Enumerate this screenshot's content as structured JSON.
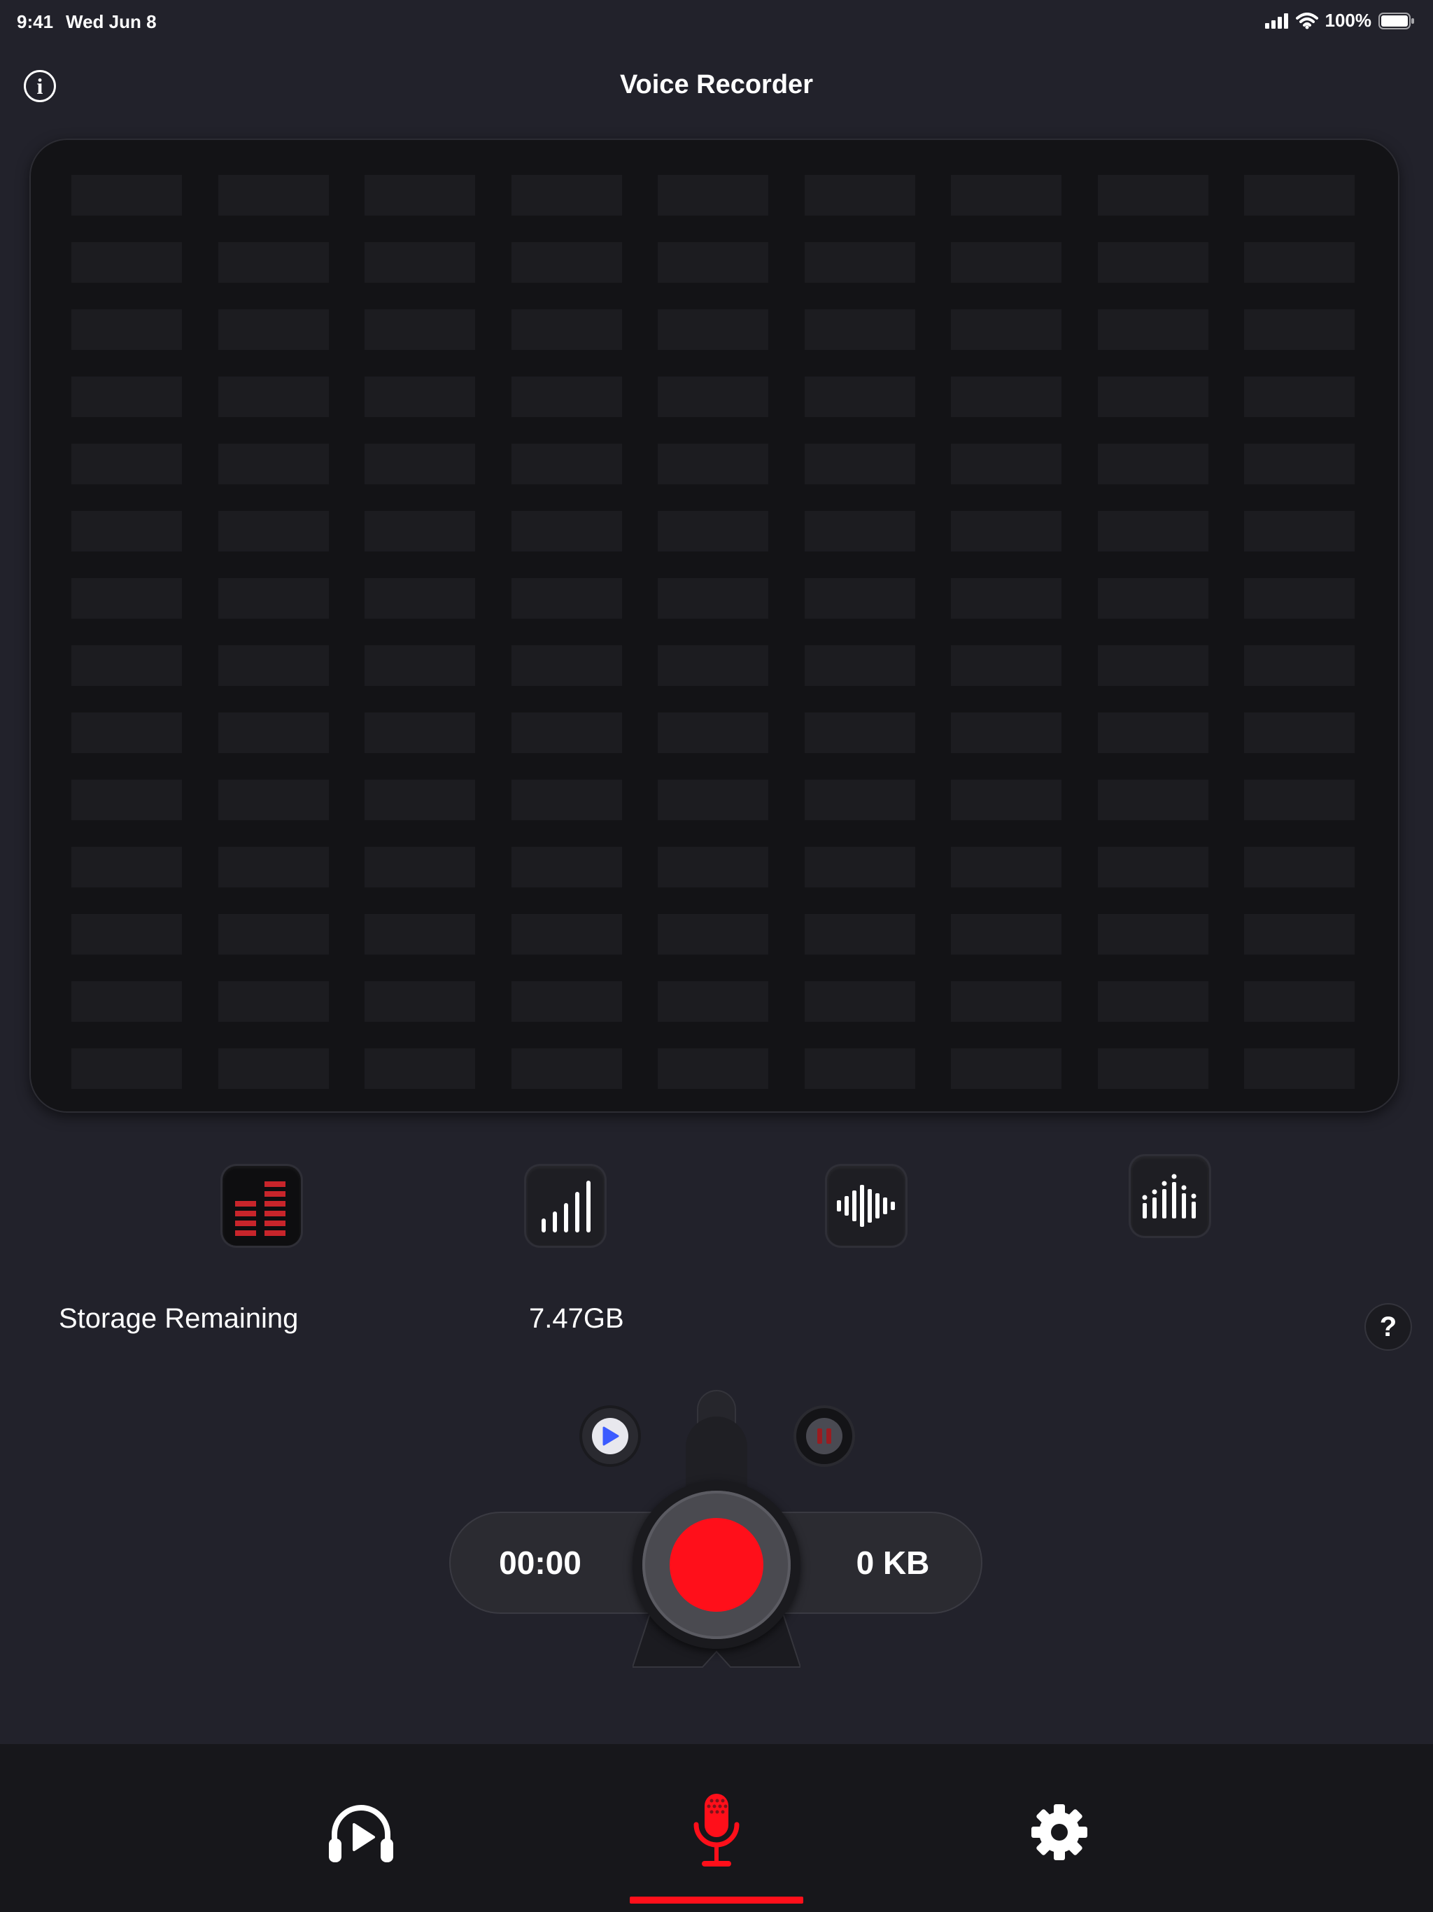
{
  "status_bar": {
    "time": "9:41",
    "date": "Wed Jun 8",
    "battery": "100%"
  },
  "header": {
    "title": "Voice Recorder",
    "info_icon": "info-icon"
  },
  "meter": {
    "columns": 9,
    "rows": 14,
    "cell_color": "#1c1c20"
  },
  "visualizer_modes": [
    {
      "name": "led-bars-icon",
      "active": true
    },
    {
      "name": "signal-bars-icon",
      "active": false
    },
    {
      "name": "waveform-icon",
      "active": false
    },
    {
      "name": "dot-bars-icon",
      "active": false
    }
  ],
  "storage": {
    "label": "Storage Remaining",
    "value": "7.47GB"
  },
  "help": {
    "label": "?"
  },
  "recorder": {
    "elapsed": "00:00",
    "file_size": "0 KB",
    "record_color": "#ff0f1a",
    "play_color": "#3b5bff",
    "pause_color": "#9a1c20"
  },
  "tabs": [
    {
      "name": "tab-playback",
      "icon": "headphones-play-icon",
      "active": false
    },
    {
      "name": "tab-record",
      "icon": "microphone-icon",
      "active": true
    },
    {
      "name": "tab-settings",
      "icon": "gear-icon",
      "active": false
    }
  ],
  "colors": {
    "background": "#22222b",
    "accent": "#ff0f1a"
  }
}
